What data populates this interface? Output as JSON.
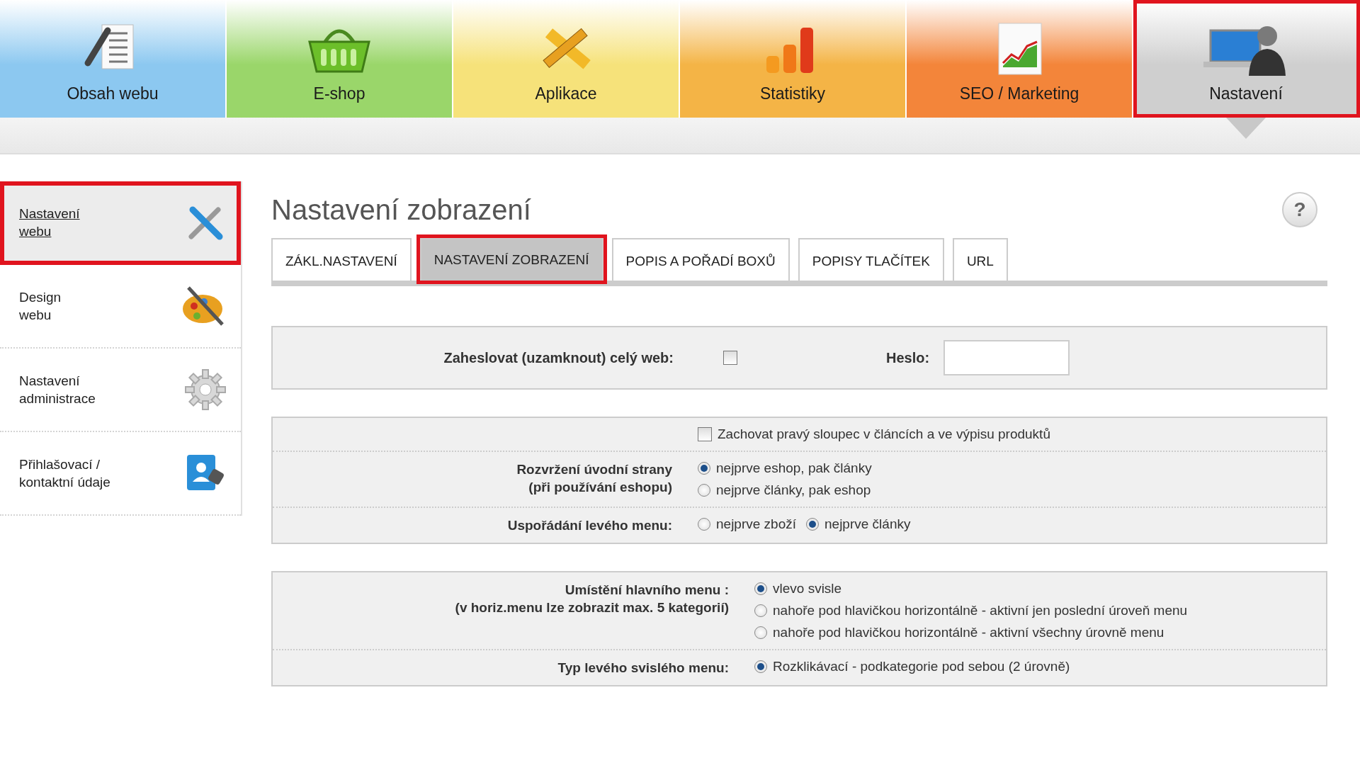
{
  "nav": [
    {
      "label": "Obsah webu",
      "color": "#8cc8f0",
      "selected": false,
      "highlighted": false
    },
    {
      "label": "E-shop",
      "color": "#9ad66a",
      "selected": false,
      "highlighted": false
    },
    {
      "label": "Aplikace",
      "color": "#f6e27a",
      "selected": false,
      "highlighted": false
    },
    {
      "label": "Statistiky",
      "color": "#f4b446",
      "selected": false,
      "highlighted": false
    },
    {
      "label": "SEO / Marketing",
      "color": "#f3853a",
      "selected": false,
      "highlighted": false
    },
    {
      "label": "Nastavení",
      "color": "#cfcfcf",
      "selected": true,
      "highlighted": true
    }
  ],
  "sidebar": {
    "items": [
      {
        "label": "Nastavení\nwebu",
        "selected": true,
        "highlighted": true
      },
      {
        "label": "Design\nwebu",
        "selected": false,
        "highlighted": false
      },
      {
        "label": "Nastavení\nadministrace",
        "selected": false,
        "highlighted": false
      },
      {
        "label": "Přihlašovací /\nkontaktní údaje",
        "selected": false,
        "highlighted": false
      }
    ]
  },
  "page": {
    "title": "Nastavení zobrazení",
    "help": "?"
  },
  "tabs": [
    {
      "label": "ZÁKL.NASTAVENÍ",
      "selected": false,
      "highlighted": false
    },
    {
      "label": "NASTAVENÍ ZOBRAZENÍ",
      "selected": true,
      "highlighted": true
    },
    {
      "label": "POPIS A POŘADÍ BOXŮ",
      "selected": false,
      "highlighted": false
    },
    {
      "label": "POPISY TLAČÍTEK",
      "selected": false,
      "highlighted": false
    },
    {
      "label": "URL",
      "selected": false,
      "highlighted": false
    }
  ],
  "panels": [
    {
      "rows": [
        {
          "kind": "lock",
          "label": "Zaheslovat (uzamknout) celý web:",
          "checked": false,
          "field_label": "Heslo:"
        }
      ]
    },
    {
      "rows": [
        {
          "kind": "checkbox",
          "label": "Zachovat pravý sloupec v článcích a ve výpisu produktů",
          "checked": false
        },
        {
          "kind": "radio-column",
          "label": "Rozvržení úvodní strany\n(při používání eshopu)",
          "options": [
            {
              "label": "nejprve eshop, pak články",
              "selected": true
            },
            {
              "label": "nejprve články, pak eshop",
              "selected": false
            }
          ]
        },
        {
          "kind": "radio-inline",
          "label": "Uspořádání levého menu:",
          "options": [
            {
              "label": "nejprve zboží",
              "selected": false
            },
            {
              "label": "nejprve články",
              "selected": true
            }
          ]
        }
      ]
    },
    {
      "rows": [
        {
          "kind": "radio-column",
          "label": "Umístění hlavního menu :\n(v horiz.menu lze zobrazit max. 5 kategorií)",
          "options": [
            {
              "label": "vlevo svisle",
              "selected": true
            },
            {
              "label": "nahoře pod hlavičkou horizontálně - aktivní jen poslední úroveň menu",
              "selected": false
            },
            {
              "label": "nahoře pod hlavičkou horizontálně - aktivní všechny úrovně menu",
              "selected": false
            }
          ]
        },
        {
          "kind": "radio-column",
          "label": "Typ levého svislého menu:",
          "options": [
            {
              "label": "Rozklikávací - podkategorie pod sebou (2 úrovně)",
              "selected": true
            }
          ]
        }
      ]
    }
  ]
}
